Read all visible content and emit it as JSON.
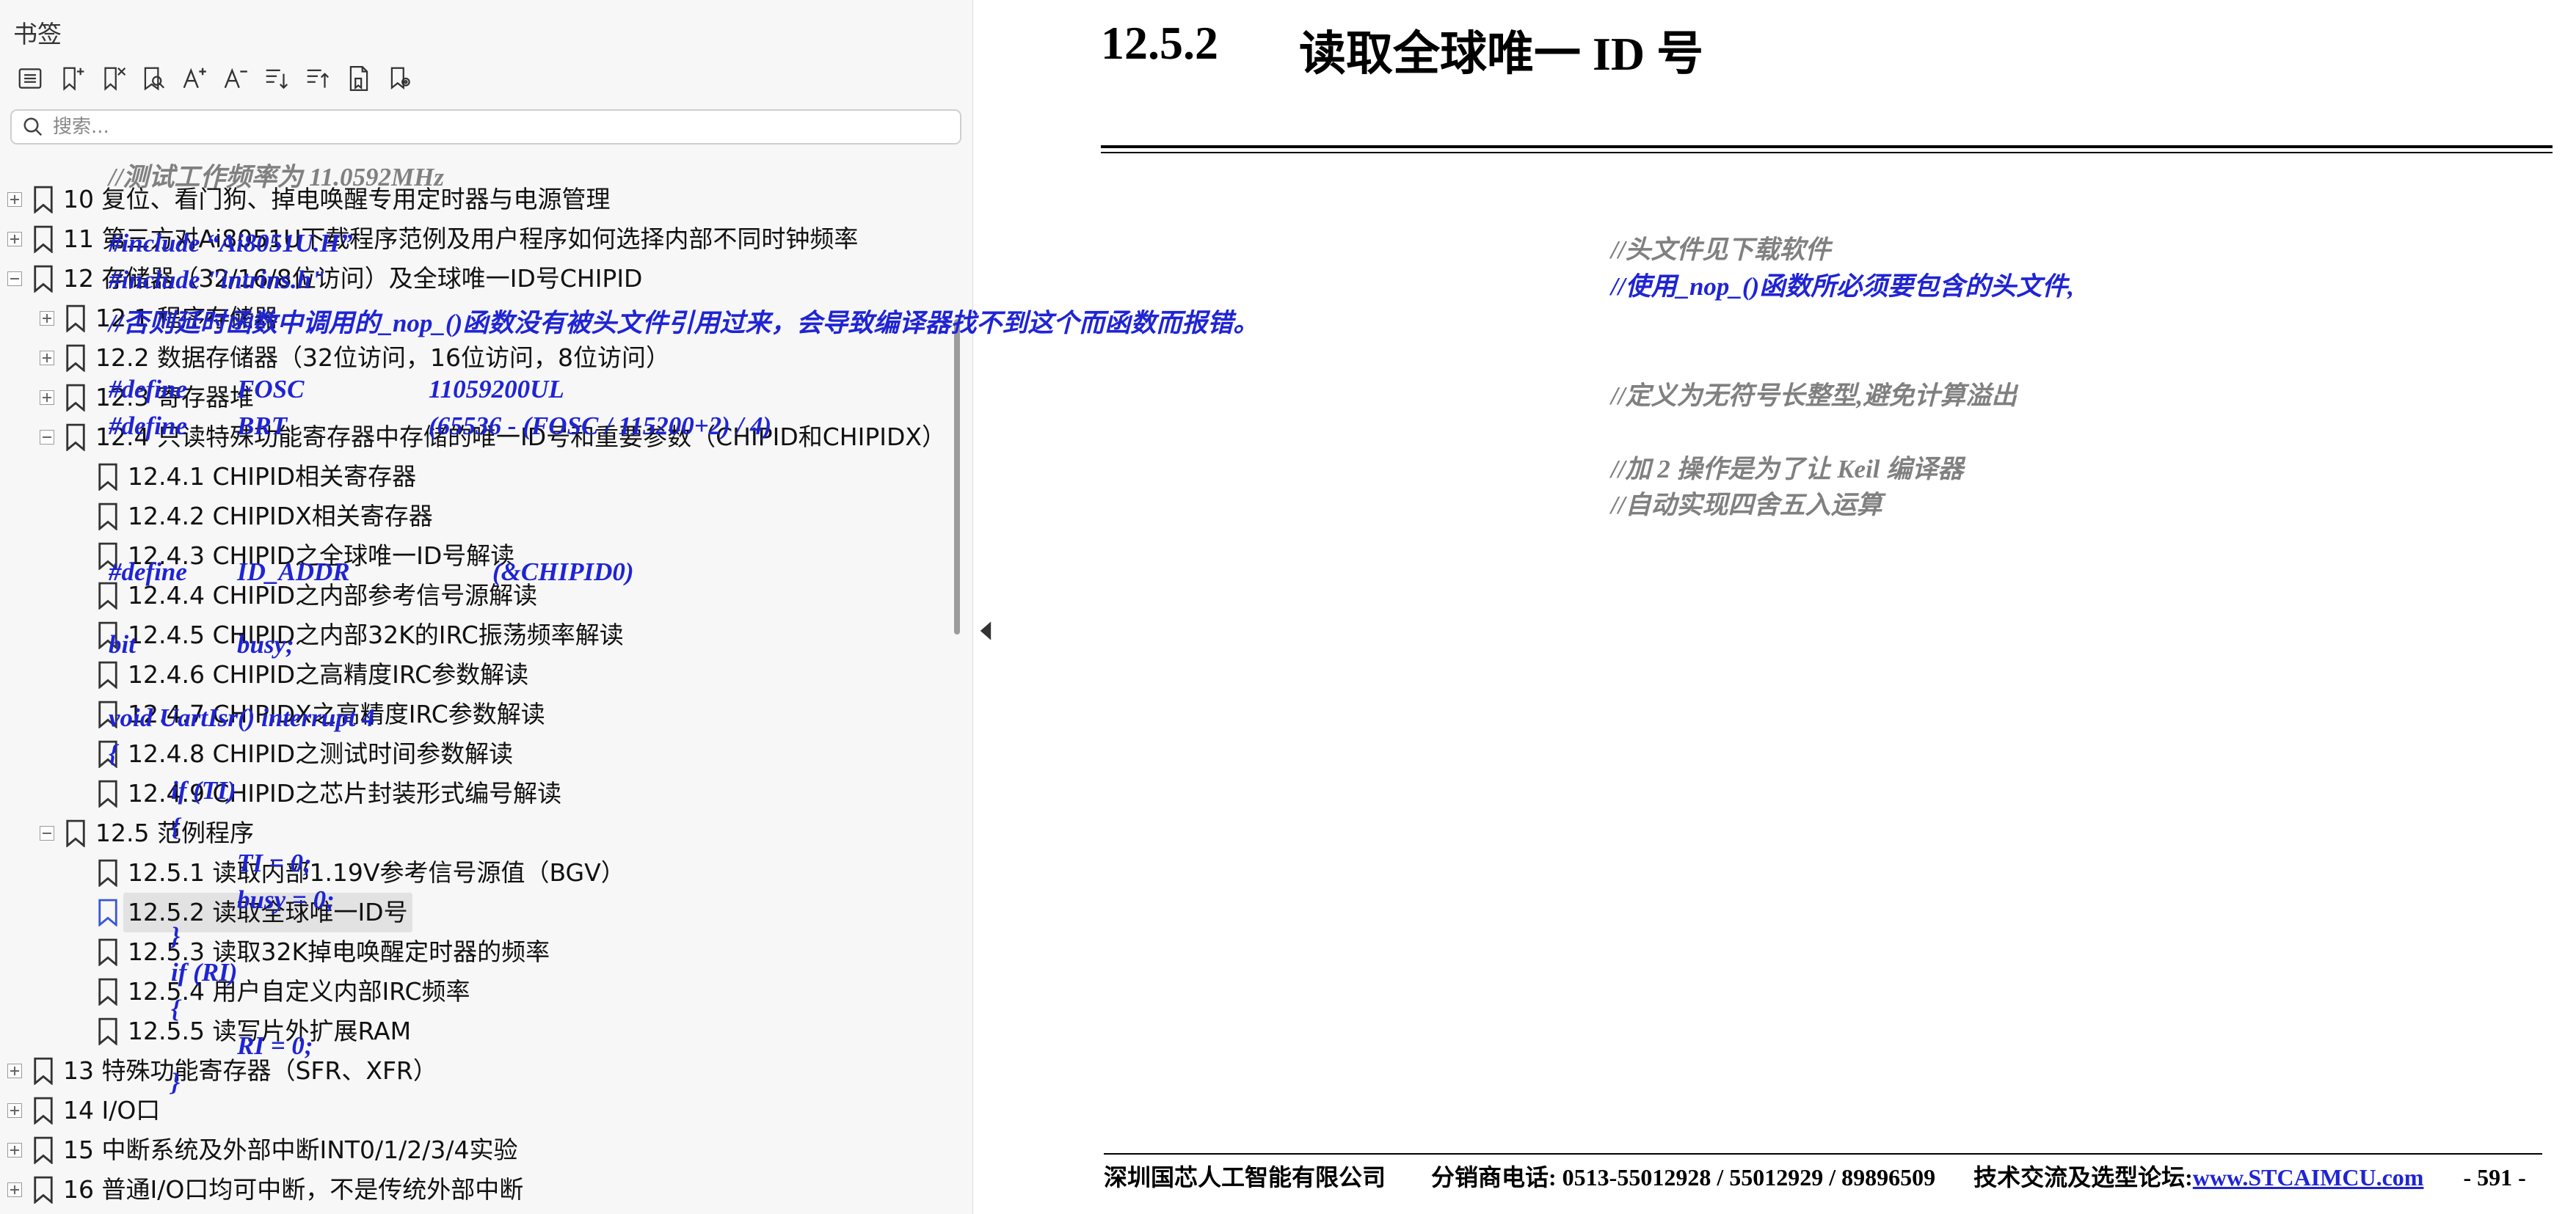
{
  "sidebar": {
    "title": "书签",
    "search_placeholder": "搜索...",
    "toolbar_icons": [
      "bookmark-list-icon",
      "add-bookmark-icon",
      "delete-bookmark-icon",
      "find-bookmark-icon",
      "increase-font-icon",
      "decrease-font-icon",
      "expand-all-icon",
      "collapse-all-icon",
      "bookmark-document-icon",
      "bookmark-settings-icon"
    ],
    "tree": [
      {
        "level": 0,
        "expander": "plus",
        "label": "10  复位、看门狗、掉电唤醒专用定时器与电源管理"
      },
      {
        "level": 0,
        "expander": "plus",
        "label": "11  第三方对Ai8051U下载程序范例及用户程序如何选择内部不同时钟频率"
      },
      {
        "level": 0,
        "expander": "minus",
        "label": "12  存储器（32/16/8位访问）及全球唯一ID号CHIPID"
      },
      {
        "level": 1,
        "expander": "plus",
        "label": "12.1  程序存储器"
      },
      {
        "level": 1,
        "expander": "plus",
        "label": "12.2  数据存储器（32位访问，16位访问，8位访问）"
      },
      {
        "level": 1,
        "expander": "plus",
        "label": "12.3  寄存器堆"
      },
      {
        "level": 1,
        "expander": "minus",
        "label": "12.4  只读特殊功能寄存器中存储的唯一ID号和重要参数（CHIPID和CHIPIDX）"
      },
      {
        "level": 2,
        "expander": "none",
        "label": "12.4.1 CHIPID相关寄存器"
      },
      {
        "level": 2,
        "expander": "none",
        "label": "12.4.2 CHIPIDX相关寄存器"
      },
      {
        "level": 2,
        "expander": "none",
        "label": "12.4.3  CHIPID之全球唯一ID号解读"
      },
      {
        "level": 2,
        "expander": "none",
        "label": "12.4.4 CHIPID之内部参考信号源解读"
      },
      {
        "level": 2,
        "expander": "none",
        "label": "12.4.5 CHIPID之内部32K的IRC振荡频率解读"
      },
      {
        "level": 2,
        "expander": "none",
        "label": "12.4.6  CHIPID之高精度IRC参数解读"
      },
      {
        "level": 2,
        "expander": "none",
        "label": "12.4.7  CHIPIDX之高精度IRC参数解读"
      },
      {
        "level": 2,
        "expander": "none",
        "label": "12.4.8  CHIPID之测试时间参数解读"
      },
      {
        "level": 2,
        "expander": "none",
        "label": "12.4.9 CHIPID之芯片封装形式编号解读"
      },
      {
        "level": 1,
        "expander": "minus",
        "label": "12.5  范例程序"
      },
      {
        "level": 2,
        "expander": "none",
        "label": "12.5.1 读取内部1.19V参考信号源值（BGV）"
      },
      {
        "level": 2,
        "expander": "none",
        "label": "12.5.2 读取全球唯一ID号",
        "selected": true
      },
      {
        "level": 2,
        "expander": "none",
        "label": "12.5.3 读取32K掉电唤醒定时器的频率"
      },
      {
        "level": 2,
        "expander": "none",
        "label": "12.5.4 用户自定义内部IRC频率"
      },
      {
        "level": 2,
        "expander": "none",
        "label": "12.5.5 读写片外扩展RAM"
      },
      {
        "level": 0,
        "expander": "plus",
        "label": "13  特殊功能寄存器（SFR、XFR）"
      },
      {
        "level": 0,
        "expander": "plus",
        "label": "14  I/O口"
      },
      {
        "level": 0,
        "expander": "plus",
        "label": "15  中断系统及外部中断INT0/1/2/3/4实验"
      },
      {
        "level": 0,
        "expander": "plus",
        "label": "16  普通I/O口均可中断，不是传统外部中断"
      }
    ]
  },
  "document": {
    "heading_number": "12.5.2",
    "heading_title": "读取全球唯一 ID 号",
    "code_lines": [
      {
        "text": "//测试工作频率为 11.0592MHz",
        "style": "gray",
        "col": 0,
        "line": 0
      },
      {
        "text": "#include “Ai8051U.H”",
        "style": "blue",
        "col": 0,
        "line": 2
      },
      {
        "text": "//头文件见下载软件",
        "style": "gray",
        "col": 3,
        "line": 2
      },
      {
        "text": "#include \"intrins.h\"",
        "style": "blue",
        "col": 0,
        "line": 3
      },
      {
        "text": "//使用_nop_()函数所必须要包含的头文件,",
        "style": "blue",
        "col": 3,
        "line": 3
      },
      {
        "text": "//否则延时函数中调用的_nop_()函数没有被头文件引用过来，会导致编译器找不到这个而函数而报错。",
        "style": "blue",
        "col": 0,
        "line": 4
      },
      {
        "text": "#define",
        "style": "blue",
        "col": 0,
        "line": 6
      },
      {
        "text": "FOSC",
        "style": "blue",
        "col": 1,
        "line": 6
      },
      {
        "text": "11059200UL",
        "style": "blue",
        "col": 2,
        "line": 6
      },
      {
        "text": "//定义为无符号长整型,避免计算溢出",
        "style": "gray",
        "col": 3,
        "line": 6
      },
      {
        "text": "#define",
        "style": "blue",
        "col": 0,
        "line": 7
      },
      {
        "text": "BRT",
        "style": "blue",
        "col": 1,
        "line": 7
      },
      {
        "text": "(65536 - (FOSC / 115200+2) / 4)",
        "style": "blue",
        "col": 2,
        "line": 7
      },
      {
        "text": "//加 2 操作是为了让 Keil 编译器",
        "style": "gray",
        "col": 3,
        "line": 8
      },
      {
        "text": "//自动实现四舍五入运算",
        "style": "gray",
        "col": 3,
        "line": 9
      },
      {
        "text": "#define",
        "style": "blue",
        "col": 0,
        "line": 11
      },
      {
        "text": "ID_ADDR",
        "style": "blue",
        "col": 1,
        "line": 11
      },
      {
        "text": "(&CHIPID0)",
        "style": "blue",
        "col": 5,
        "line": 11
      },
      {
        "text": "bit",
        "style": "blue",
        "col": 0,
        "line": 13
      },
      {
        "text": "busy;",
        "style": "blue",
        "col": 1,
        "line": 13
      },
      {
        "text": "void UartIsr() interrupt 4",
        "style": "blue",
        "col": 0,
        "line": 15
      },
      {
        "text": "{",
        "style": "blue",
        "col": 0,
        "line": 16
      },
      {
        "text": "if (TI)",
        "style": "blue",
        "col": 4,
        "line": 17
      },
      {
        "text": "{",
        "style": "blue",
        "col": 4,
        "line": 18
      },
      {
        "text": "TI = 0;",
        "style": "blue",
        "col": 1,
        "line": 19
      },
      {
        "text": "busy = 0;",
        "style": "blue",
        "col": 1,
        "line": 20
      },
      {
        "text": "}",
        "style": "blue",
        "col": 4,
        "line": 21
      },
      {
        "text": "if (RI)",
        "style": "blue",
        "col": 4,
        "line": 22
      },
      {
        "text": "{",
        "style": "blue",
        "col": 4,
        "line": 23
      },
      {
        "text": "RI = 0;",
        "style": "blue",
        "col": 1,
        "line": 24
      },
      {
        "text": "}",
        "style": "blue",
        "col": 4,
        "line": 25
      }
    ],
    "footer": {
      "company": "深圳国芯人工智能有限公司",
      "phone": "分销商电话: 0513-55012928 / 55012929 / 89896509",
      "forum_label": "技术交流及选型论坛:",
      "forum_link": "www.STCAIMCU.com",
      "page": "- 591 -"
    }
  },
  "colors": {
    "code_blue": "#1f24d4",
    "comment_gray": "#808080",
    "sidebar_bg": "#f7f7f7",
    "selected_bg": "#e2e2e2"
  }
}
